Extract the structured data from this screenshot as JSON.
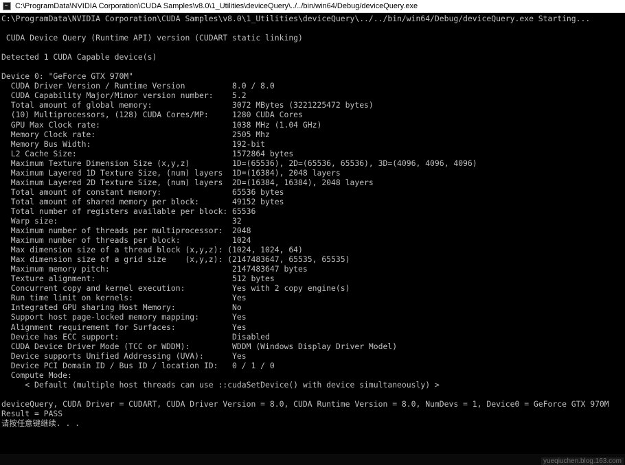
{
  "window": {
    "title": "C:\\ProgramData\\NVIDIA Corporation\\CUDA Samples\\v8.0\\1_Utilities\\deviceQuery\\../../bin/win64/Debug/deviceQuery.exe",
    "icon": "console-app-icon"
  },
  "console": {
    "lines": [
      "C:\\ProgramData\\NVIDIA Corporation\\CUDA Samples\\v8.0\\1_Utilities\\deviceQuery\\../../bin/win64/Debug/deviceQuery.exe Starting...",
      "",
      " CUDA Device Query (Runtime API) version (CUDART static linking)",
      "",
      "Detected 1 CUDA Capable device(s)",
      "",
      "Device 0: \"GeForce GTX 970M\"",
      "  CUDA Driver Version / Runtime Version          8.0 / 8.0",
      "  CUDA Capability Major/Minor version number:    5.2",
      "  Total amount of global memory:                 3072 MBytes (3221225472 bytes)",
      "  (10) Multiprocessors, (128) CUDA Cores/MP:     1280 CUDA Cores",
      "  GPU Max Clock rate:                            1038 MHz (1.04 GHz)",
      "  Memory Clock rate:                             2505 Mhz",
      "  Memory Bus Width:                              192-bit",
      "  L2 Cache Size:                                 1572864 bytes",
      "  Maximum Texture Dimension Size (x,y,z)         1D=(65536), 2D=(65536, 65536), 3D=(4096, 4096, 4096)",
      "  Maximum Layered 1D Texture Size, (num) layers  1D=(16384), 2048 layers",
      "  Maximum Layered 2D Texture Size, (num) layers  2D=(16384, 16384), 2048 layers",
      "  Total amount of constant memory:               65536 bytes",
      "  Total amount of shared memory per block:       49152 bytes",
      "  Total number of registers available per block: 65536",
      "  Warp size:                                     32",
      "  Maximum number of threads per multiprocessor:  2048",
      "  Maximum number of threads per block:           1024",
      "  Max dimension size of a thread block (x,y,z): (1024, 1024, 64)",
      "  Max dimension size of a grid size    (x,y,z): (2147483647, 65535, 65535)",
      "  Maximum memory pitch:                          2147483647 bytes",
      "  Texture alignment:                             512 bytes",
      "  Concurrent copy and kernel execution:          Yes with 2 copy engine(s)",
      "  Run time limit on kernels:                     Yes",
      "  Integrated GPU sharing Host Memory:            No",
      "  Support host page-locked memory mapping:       Yes",
      "  Alignment requirement for Surfaces:            Yes",
      "  Device has ECC support:                        Disabled",
      "  CUDA Device Driver Mode (TCC or WDDM):         WDDM (Windows Display Driver Model)",
      "  Device supports Unified Addressing (UVA):      Yes",
      "  Device PCI Domain ID / Bus ID / location ID:   0 / 1 / 0",
      "  Compute Mode:",
      "     < Default (multiple host threads can use ::cudaSetDevice() with device simultaneously) >",
      "",
      "deviceQuery, CUDA Driver = CUDART, CUDA Driver Version = 8.0, CUDA Runtime Version = 8.0, NumDevs = 1, Device0 = GeForce GTX 970M",
      "Result = PASS",
      "请按任意键继续. . ."
    ]
  },
  "watermark": "yueqiuchen.blog.163.com",
  "colors": {
    "background": "#000000",
    "text": "#c0c0c0",
    "titlebar": "#ffffff"
  }
}
